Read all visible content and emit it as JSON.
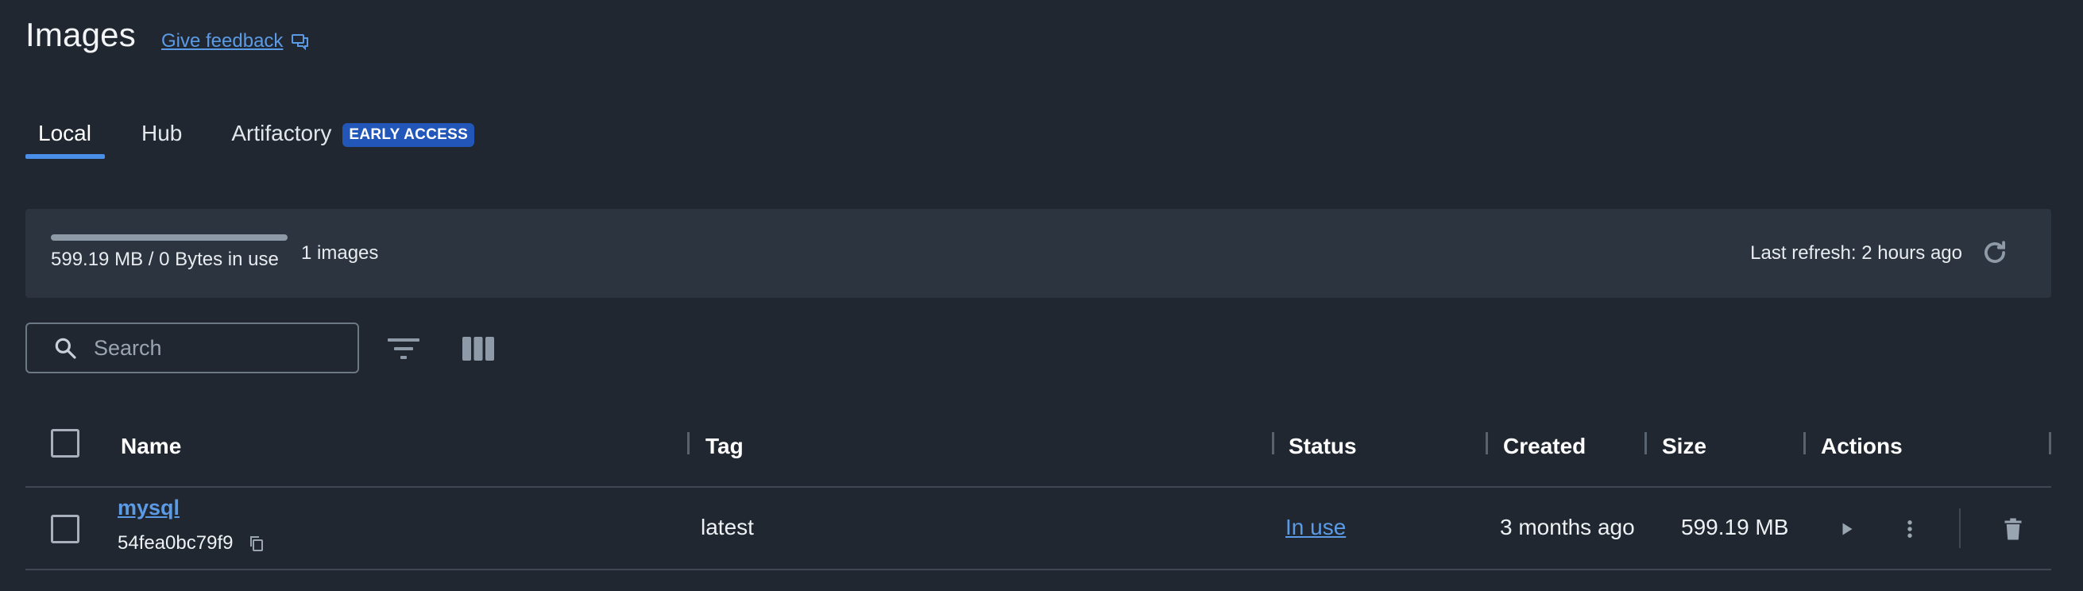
{
  "header": {
    "title": "Images",
    "feedback_label": "Give feedback"
  },
  "tabs": [
    {
      "label": "Local",
      "active": true
    },
    {
      "label": "Hub",
      "active": false
    },
    {
      "label": "Artifactory",
      "active": false,
      "badge": "EARLY ACCESS"
    }
  ],
  "summary": {
    "usage_text": "599.19 MB / 0 Bytes in use",
    "usage_fraction": 1.0,
    "images_count": "1 images",
    "refresh_text": "Last refresh: 2 hours ago"
  },
  "search": {
    "placeholder": "Search",
    "value": ""
  },
  "table": {
    "columns": [
      "Name",
      "Tag",
      "Status",
      "Created",
      "Size",
      "Actions"
    ],
    "rows": [
      {
        "name": "mysql",
        "id": "54fea0bc79f9",
        "tag": "latest",
        "status": "In use",
        "created": "3 months ago",
        "size": "599.19 MB"
      }
    ]
  },
  "icons": {
    "feedback": "feedback-icon",
    "refresh": "refresh-icon",
    "search": "search-icon",
    "filter": "filter-icon",
    "columns": "columns-icon",
    "copy": "copy-icon",
    "run": "play-icon",
    "more": "more-vertical-icon",
    "delete": "trash-icon"
  },
  "colors": {
    "background": "#202730",
    "panel": "#2c353f",
    "accent": "#4a8fe7",
    "link": "#5b9be6",
    "badge": "#2256b8"
  }
}
